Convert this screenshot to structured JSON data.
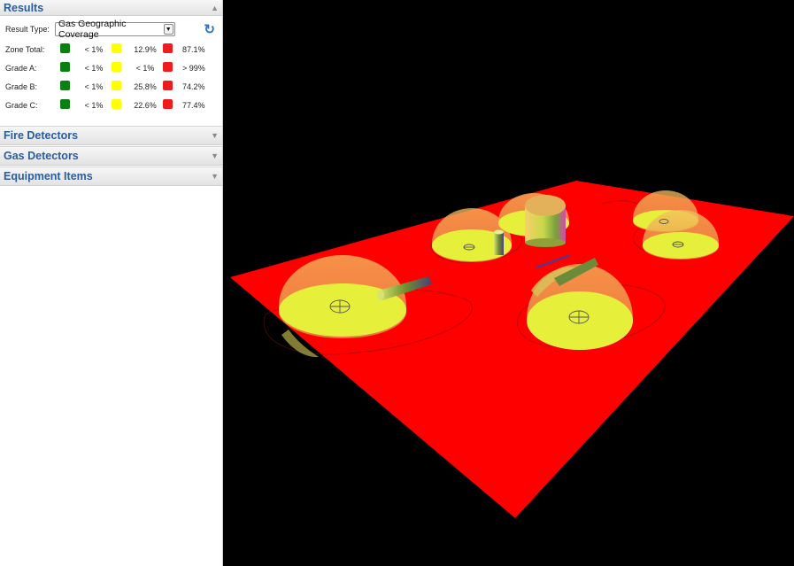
{
  "panel": {
    "results": {
      "title": "Results",
      "result_type_label": "Result Type:",
      "result_type_value": "Gas Geographic Coverage",
      "colors": {
        "green": "#0a7f12",
        "yellow": "#ffff00",
        "red": "#ee1c1c"
      },
      "rows": [
        {
          "name": "Zone Total:",
          "green": "< 1%",
          "yellow": "12.9%",
          "red": "87.1%"
        },
        {
          "name": "Grade A:",
          "green": "< 1%",
          "yellow": "< 1%",
          "red": "> 99%"
        },
        {
          "name": "Grade B:",
          "green": "< 1%",
          "yellow": "25.8%",
          "red": "74.2%"
        },
        {
          "name": "Grade C:",
          "green": "< 1%",
          "yellow": "22.6%",
          "red": "77.4%"
        }
      ]
    },
    "sections": [
      {
        "title": "Fire Detectors"
      },
      {
        "title": "Gas Detectors"
      },
      {
        "title": "Equipment Items"
      }
    ]
  }
}
